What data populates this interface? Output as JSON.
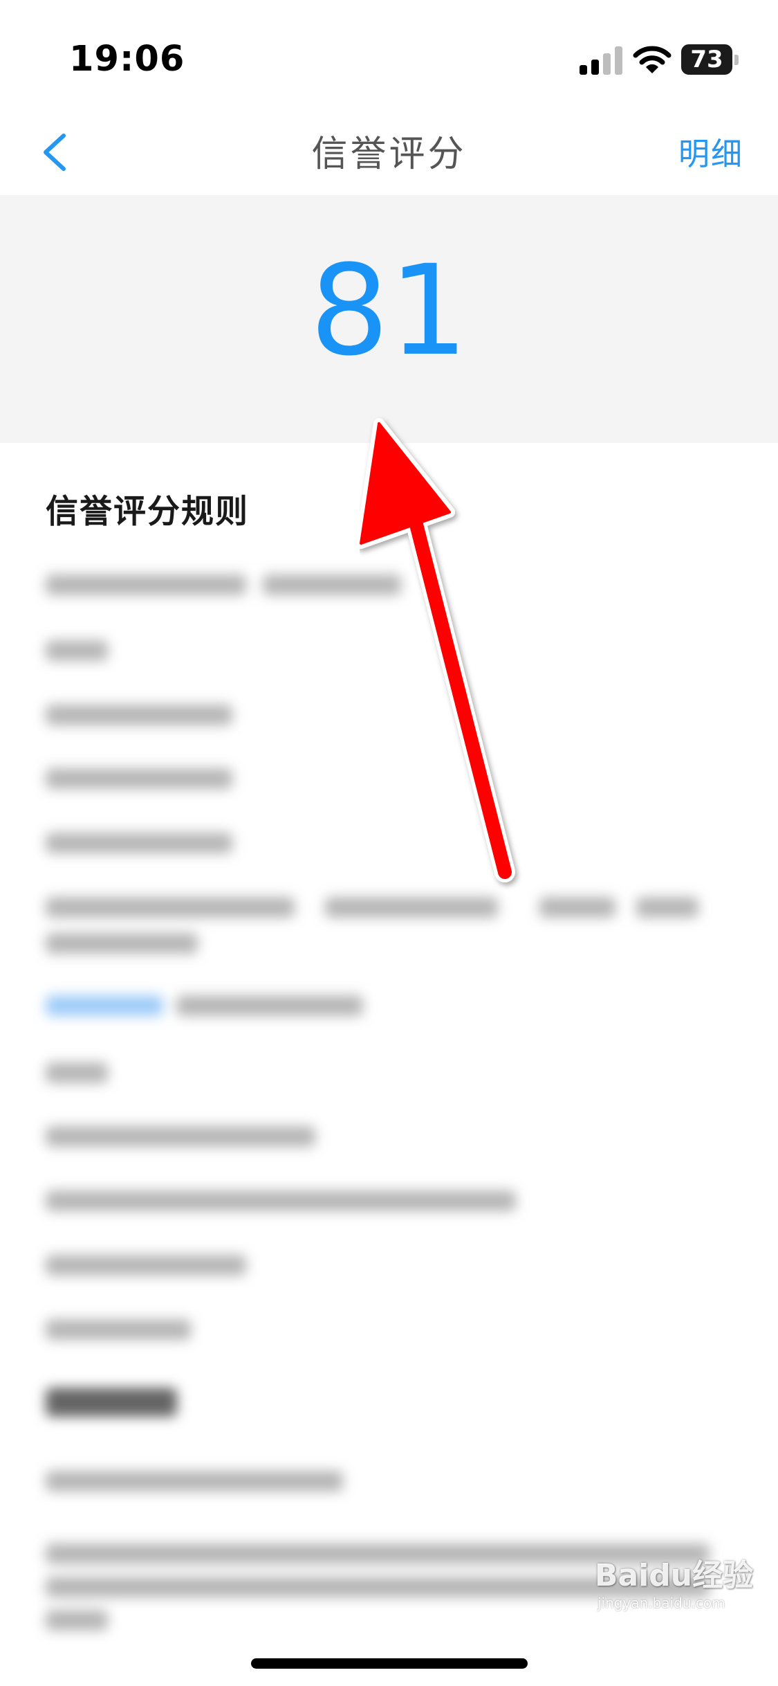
{
  "status_bar": {
    "time": "19:06",
    "battery_level": "73",
    "icons": [
      "signal-icon",
      "wifi-icon",
      "battery-icon"
    ]
  },
  "nav": {
    "title": "信誉评分",
    "back_icon": "chevron-left-icon",
    "detail_label": "明细"
  },
  "score": {
    "value": "81"
  },
  "rules": {
    "title": "信誉评分规则"
  },
  "annotation": {
    "arrow_color": "#ff0000"
  },
  "watermark": {
    "logo_text": "Baidu经验",
    "sub_text": "jingyan.baidu.com"
  },
  "colors": {
    "accent": "#1993f5",
    "link": "#2696f3",
    "score_panel_bg": "#f4f4f4"
  }
}
